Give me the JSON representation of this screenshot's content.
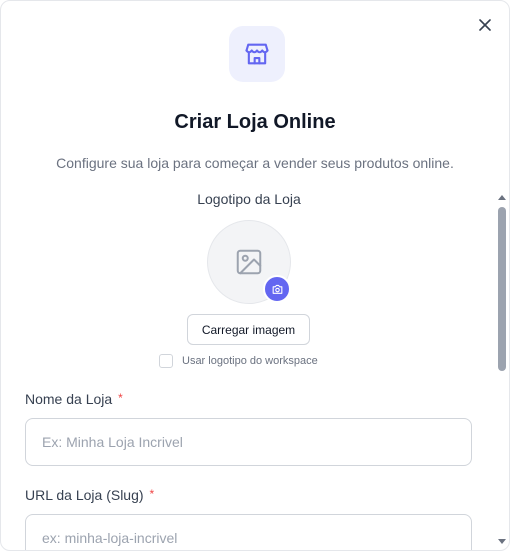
{
  "dialog": {
    "title": "Criar Loja Online",
    "subtitle": "Configure sua loja para começar a vender seus produtos online.",
    "close_icon": "close-icon",
    "header_icon": "storefront-icon",
    "accent_color": "#6366f1"
  },
  "logo": {
    "label": "Logotipo da Loja",
    "placeholder_icon": "image-icon",
    "camera_icon": "camera-icon",
    "upload_label": "Carregar imagem",
    "use_workspace_logo_label": "Usar logotipo do workspace",
    "use_workspace_logo_checked": false
  },
  "fields": {
    "store_name": {
      "label": "Nome da Loja",
      "required_mark": "*",
      "value": "",
      "placeholder": "Ex: Minha Loja Incrivel"
    },
    "store_url": {
      "label": "URL da Loja (Slug)",
      "required_mark": "*",
      "value": "",
      "placeholder": "ex: minha-loja-incrivel"
    }
  }
}
